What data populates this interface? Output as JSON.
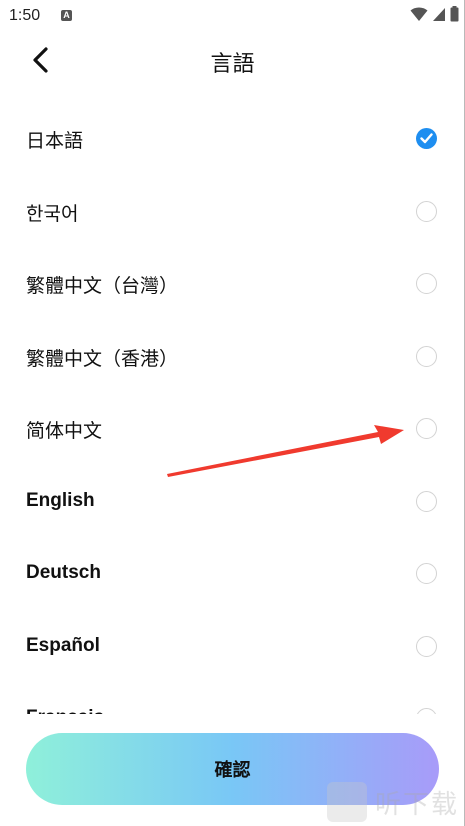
{
  "status_bar": {
    "time": "1:50",
    "notification_badge": "A",
    "icons": [
      "wifi-icon",
      "signal-icon",
      "battery-icon"
    ]
  },
  "header": {
    "title": "言語",
    "back_icon": "chevron-left-icon"
  },
  "languages": [
    {
      "label": "日本語",
      "selected": true
    },
    {
      "label": "한국어",
      "selected": false
    },
    {
      "label": "繁體中文（台灣）",
      "selected": false
    },
    {
      "label": "繁體中文（香港）",
      "selected": false
    },
    {
      "label": "简体中文",
      "selected": false
    },
    {
      "label": "English",
      "selected": false
    },
    {
      "label": "Deutsch",
      "selected": false
    },
    {
      "label": "Español",
      "selected": false
    },
    {
      "label": "Français",
      "selected": false
    }
  ],
  "confirm_button": {
    "label": "確認"
  },
  "watermark": {
    "text": "听下载"
  },
  "colors": {
    "accent": "#1e8ef0",
    "annotation_arrow": "#f03a2e",
    "button_gradient": [
      "#8ff0da",
      "#79c7f6",
      "#a89bf9"
    ]
  }
}
